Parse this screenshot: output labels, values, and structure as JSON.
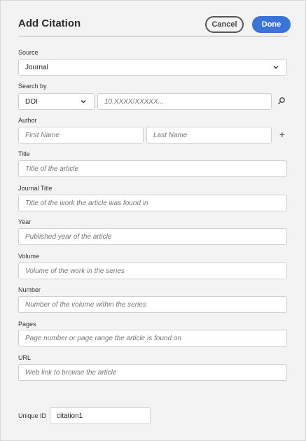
{
  "dialog": {
    "title": "Add Citation",
    "cancel_label": "Cancel",
    "done_label": "Done"
  },
  "source": {
    "label": "Source",
    "value": "Journal"
  },
  "search_by": {
    "label": "Search by",
    "type_value": "DOI",
    "placeholder": "10.XXXX/XXXXX..."
  },
  "author": {
    "label": "Author",
    "first_placeholder": "First Name",
    "last_placeholder": "Last Name",
    "add_glyph": "+"
  },
  "fields": {
    "title": {
      "label": "Title",
      "placeholder": "Title of the article"
    },
    "journal_title": {
      "label": "Journal Title",
      "placeholder": "Title of the work the article was found in"
    },
    "year": {
      "label": "Year",
      "placeholder": "Published year of the article"
    },
    "volume": {
      "label": "Volume",
      "placeholder": "Volume of the work in the series"
    },
    "number": {
      "label": "Number",
      "placeholder": "Number of the volume within the series"
    },
    "pages": {
      "label": "Pages",
      "placeholder": "Page number or page range the article is found on"
    },
    "url": {
      "label": "URL",
      "placeholder": "Web link to browse the article"
    }
  },
  "unique_id": {
    "label": "Unique ID",
    "value": "citation1"
  },
  "colors": {
    "accent": "#3a74d9",
    "background": "#f3f3f3"
  },
  "icons": {
    "dropdown": "chevron-down-icon",
    "search": "search-icon",
    "add": "plus-icon"
  }
}
